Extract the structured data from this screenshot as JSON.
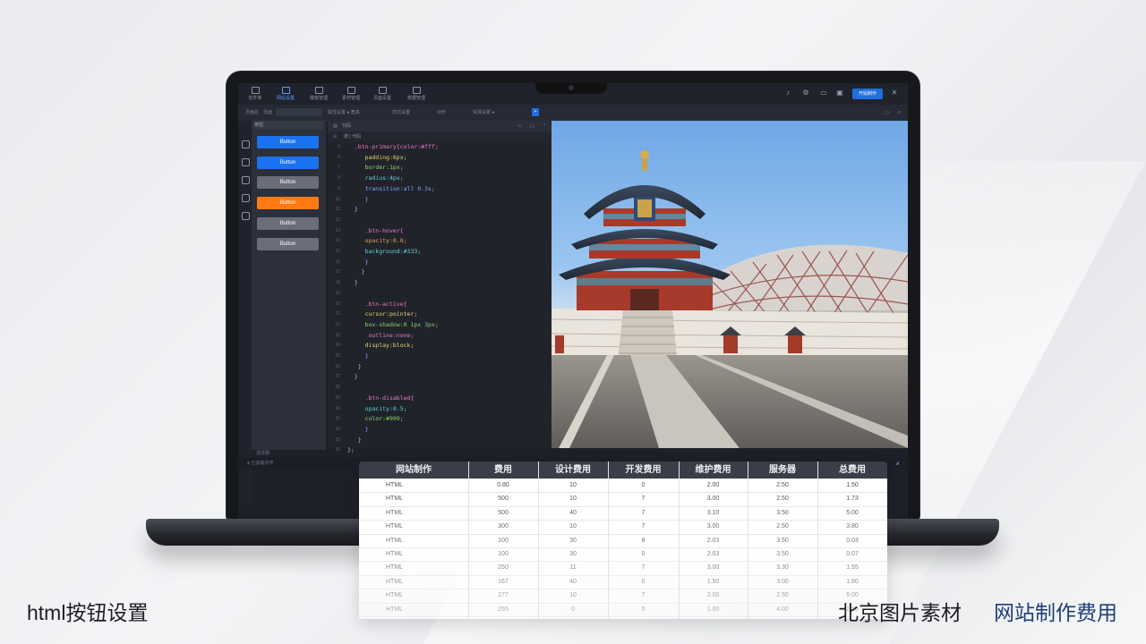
{
  "app": {
    "toolbar": [
      "控件库",
      "网站设置",
      "模板管理",
      "素材管理",
      "页面设置",
      "数据管理"
    ],
    "run_label": "开始制作",
    "subbar": [
      "页面名",
      "页面",
      "属性设置 ● 宽高",
      "样式设置",
      "动作",
      "资源设置 ●"
    ],
    "panel_title": "按钮",
    "panel_footer": "选择器",
    "status_text": "● 已加载完毕",
    "editor_tab": "代码",
    "editor_path": "按  |  代码",
    "colors": {
      "primary": "#1f6fe0",
      "orange": "#ff7a14",
      "gray": "#5c616c",
      "dark": "#1d2029"
    }
  },
  "buttons": [
    {
      "label": "Button",
      "color": "#1a73f0"
    },
    {
      "label": "Button",
      "color": "#1a73f0"
    },
    {
      "label": "Button",
      "color": "#6a6e78"
    },
    {
      "label": "Button",
      "color": "#ff7a14"
    },
    {
      "label": "Button",
      "color": "#6a6e78"
    },
    {
      "label": "Button",
      "color": "#6a6e78"
    }
  ],
  "code_lines": [
    {
      "n": "9",
      "t": "  .btn-primary{color:#fff;",
      "c": "c-p"
    },
    {
      "n": "6",
      "t": "     padding:6px;",
      "c": "c-y"
    },
    {
      "n": "7",
      "t": "     border:1px;",
      "c": "c-g"
    },
    {
      "n": "8",
      "t": "     radius:4px;",
      "c": "c-c"
    },
    {
      "n": "9",
      "t": "     transition:all 0.3s;",
      "c": "c-b"
    },
    {
      "n": "10",
      "t": "     }",
      "c": "c-b"
    },
    {
      "n": "11",
      "t": "  }",
      "c": "c-w"
    },
    {
      "n": "12",
      "t": "",
      "c": "c-w"
    },
    {
      "n": "13",
      "t": "     .btn-hover{",
      "c": "c-p"
    },
    {
      "n": "14",
      "t": "     opacity:0.8;",
      "c": "c-o"
    },
    {
      "n": "15",
      "t": "     background:#333;",
      "c": "c-c"
    },
    {
      "n": "16",
      "t": "     }",
      "c": "c-b"
    },
    {
      "n": "17",
      "t": "    }",
      "c": "c-w"
    },
    {
      "n": "18",
      "t": "  }",
      "c": "c-w"
    },
    {
      "n": "19",
      "t": "",
      "c": "c-w"
    },
    {
      "n": "20",
      "t": "     .btn-active{",
      "c": "c-p"
    },
    {
      "n": "21",
      "t": "     cursor:pointer;",
      "c": "c-y"
    },
    {
      "n": "22",
      "t": "     box-shadow:0 1px 3px;",
      "c": "c-g"
    },
    {
      "n": "23",
      "t": "      outline:none;",
      "c": "c-p"
    },
    {
      "n": "24",
      "t": "     display:block;",
      "c": "c-y"
    },
    {
      "n": "25",
      "t": "     }",
      "c": "c-b"
    },
    {
      "n": "26",
      "t": "   }",
      "c": "c-w"
    },
    {
      "n": "27",
      "t": "  }",
      "c": "c-w"
    },
    {
      "n": "28",
      "t": "",
      "c": "c-w"
    },
    {
      "n": "29",
      "t": "     .btn-disabled{",
      "c": "c-p"
    },
    {
      "n": "30",
      "t": "     opacity:0.5;",
      "c": "c-c"
    },
    {
      "n": "31",
      "t": "     color:#999;",
      "c": "c-g"
    },
    {
      "n": "32",
      "t": "     }",
      "c": "c-b"
    },
    {
      "n": "33",
      "t": "   }",
      "c": "c-w"
    },
    {
      "n": "34",
      "t": "};",
      "c": "c-w"
    },
    {
      "n": "35",
      "t": "",
      "c": "c-w"
    }
  ],
  "table": {
    "headers": [
      "网站制作",
      "费用",
      "设计费用",
      "开发费用",
      "维护费用",
      "服务器",
      "总费用"
    ],
    "rows": [
      [
        "HTML",
        "0.80",
        "10",
        "0",
        "2.00",
        "2.50",
        "1.50"
      ],
      [
        "HTML",
        "500",
        "10",
        "7",
        "3.00",
        "2.50",
        "1.73"
      ],
      [
        "HTML",
        "500",
        "40",
        "7",
        "3.10",
        "3.50",
        "5.00"
      ],
      [
        "HTML",
        "300",
        "10",
        "7",
        "3.00",
        "2.50",
        "3.80"
      ],
      [
        "HTML",
        "100",
        "30",
        "8",
        "2.03",
        "3.50",
        "0.03"
      ],
      [
        "HTML",
        "100",
        "30",
        "0",
        "2.03",
        "3.50",
        "0.07"
      ],
      [
        "HTML",
        "250",
        "11",
        "7",
        "3.00",
        "3.30",
        "1.55"
      ],
      [
        "HTML",
        "167",
        "40",
        "0",
        "1.50",
        "3.00",
        "1.80"
      ],
      [
        "HTML",
        "277",
        "10",
        "7",
        "2.00",
        "2.50",
        "5.00"
      ],
      [
        "HTML",
        "255",
        "0",
        "0",
        "1.00",
        "4.00",
        "2.00"
      ]
    ]
  },
  "captions": {
    "left": "html按钮设置",
    "middle": "北京图片素材",
    "right": "网站制作费用"
  }
}
